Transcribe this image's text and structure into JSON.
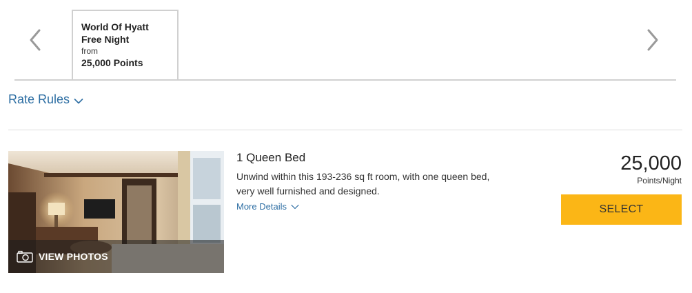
{
  "rate_tabs": {
    "prev_icon": "chevron-left-icon",
    "next_icon": "chevron-right-icon",
    "items": [
      {
        "name": "World Of Hyatt\nFree Night",
        "from_label": "from",
        "price": "25,000 Points"
      }
    ]
  },
  "rate_rules": {
    "label": "Rate Rules",
    "icon": "chevron-down-icon"
  },
  "room": {
    "photo_label": "VIEW PHOTOS",
    "photo_icon": "camera-icon",
    "title": "1 Queen Bed",
    "description": "Unwind within this 193-236 sq ft room, with one queen bed, very well furnished and designed.",
    "more_details_label": "More Details",
    "price": "25,000",
    "price_unit": "Points/Night",
    "select_label": "SELECT"
  },
  "colors": {
    "link": "#2d6ea3",
    "select_button": "#fbb616",
    "tab_border": "#d0d0d0"
  }
}
